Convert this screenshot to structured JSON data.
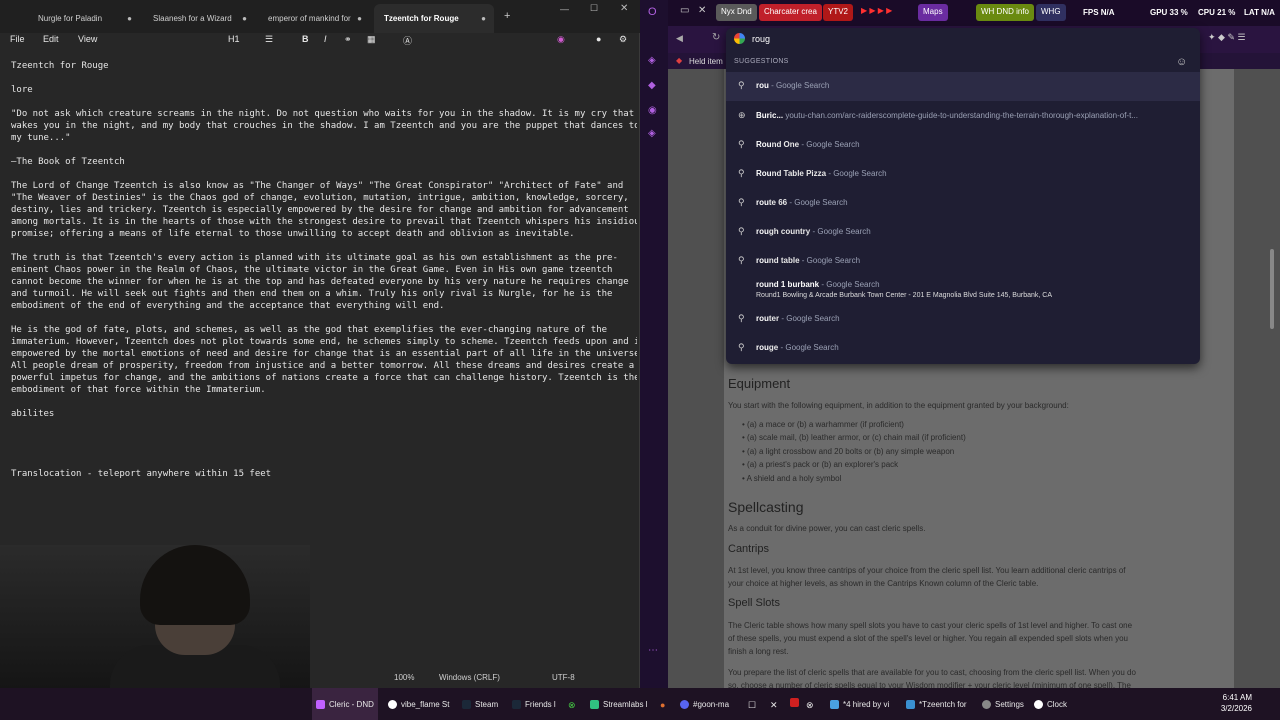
{
  "notepad": {
    "tabs": [
      "Nurgle for Paladin",
      "Slaanesh for a Wizard",
      "emperor of mankind for",
      "Tzeentch for Rouge"
    ],
    "menu": {
      "file": "File",
      "edit": "Edit",
      "view": "View",
      "heading": "H1"
    },
    "lines": [
      "Tzeentch for Rouge",
      "",
      "lore",
      "",
      "\"Do not ask which creature screams in the night. Do not question who waits for you in the shadow. It is my cry that",
      "wakes you in the night, and my body that crouches in the shadow. I am Tzeentch and you are the puppet that dances to",
      "my tune...\"",
      "",
      "—The Book of Tzeentch",
      "",
      "The Lord of Change Tzeentch is also know as \"The Changer of Ways\" \"The Great Conspirator\" \"Architect of Fate\" and",
      "\"The Weaver of Destinies\" is the Chaos god of change, evolution, mutation, intrigue, ambition, knowledge, sorcery,",
      "destiny, lies and trickery. Tzeentch is especially empowered by the desire for change and ambition for advancement",
      "among mortals. It is in the hearts of those with the strongest desire to prevail that Tzeentch whispers his insidious",
      "promise; offering a means of life eternal to those unwilling to accept death and oblivion as inevitable.",
      "",
      "The truth is that Tzeentch's every action is planned with its ultimate goal as his own establishment as the pre-",
      "eminent Chaos power in the Realm of Chaos, the ultimate victor in the Great Game. Even in His own game tzeentch",
      "cannot become the winner for when he is at the top and has defeated everyone by his very nature he requires change",
      "and turmoil. He will seek out fights and then end them on a whim. Truly his only rival is Nurgle, for he is the",
      "embodiment of the end of everything and the acceptance that everything will end.",
      "",
      "He is the god of fate, plots, and schemes, as well as the god that exemplifies the ever-changing nature of the",
      "immaterium. However, Tzeentch does not plot towards some end, he schemes simply to scheme. Tzeentch feeds upon and is",
      "empowered by the mortal emotions of need and desire for change that is an essential part of all life in the universe.",
      "All people dream of prosperity, freedom from injustice and a better tomorrow. All these dreams and desires create a",
      "powerful impetus for change, and the ambitions of nations create a force that can challenge history. Tzeentch is the",
      "embodiment of that force within the Immaterium.",
      "",
      "abilites",
      "",
      "",
      "",
      "",
      "Translocation - teleport anywhere within 15 feet"
    ],
    "status": {
      "zoom": "100%",
      "eol": "Windows (CRLF)",
      "enc": "UTF-8"
    }
  },
  "browser": {
    "bookmarks": [
      {
        "label": "Nyx Dnd",
        "color": "#5a5a5a"
      },
      {
        "label": "Charcater crea",
        "color": "#c0202a"
      },
      {
        "label": "YTV2",
        "color": "#b01818"
      },
      {
        "label": "Maps",
        "color": "#6a2ca0"
      },
      {
        "label": "WH DND info",
        "color": "#6a8a10"
      },
      {
        "label": "WHG",
        "color": "#303060"
      }
    ],
    "stats": {
      "fps": "FPS N/A",
      "gpu": "GPU 33 %",
      "cpu": "CPU 21 %",
      "lat": "LAT N/A"
    },
    "held_item": "Held item",
    "omnibox_value": "roug",
    "suggestions_header": "SUGGESTIONS",
    "suggestions": [
      {
        "icon": "search",
        "bold": "rou",
        "rest": "",
        "suffix": " - Google Search"
      },
      {
        "icon": "globe",
        "bold": "Buric...",
        "rest": "",
        "suffix": "  youtu-chan.com/arc-raiderscomplete-guide-to-understanding-the-terrain-thorough-explanation-of-t..."
      },
      {
        "icon": "search",
        "bold": "Rou",
        "rest": "nd One",
        "suffix": " - Google Search"
      },
      {
        "icon": "search",
        "bold": "Rou",
        "rest": "nd Table Pizza",
        "suffix": " - Google Search"
      },
      {
        "icon": "search",
        "bold": "rou",
        "rest": "te 66",
        "suffix": " - Google Search"
      },
      {
        "icon": "search",
        "bold": "rou",
        "rest": "gh country",
        "suffix": " - Google Search"
      },
      {
        "icon": "search",
        "bold": "rou",
        "rest": "nd table",
        "suffix": " - Google Search"
      },
      {
        "icon": "none",
        "bold": "round 1 burbank",
        "rest": "",
        "suffix": " - Google Search",
        "sub": "Round1 Bowling & Arcade Burbank Town Center - 201 E Magnolia Blvd Suite 145, Burbank, CA"
      },
      {
        "icon": "search",
        "bold": "rou",
        "rest": "ter",
        "suffix": " - Google Search"
      },
      {
        "icon": "search",
        "bold": "rou",
        "rest": "ge",
        "suffix": " - Google Search"
      }
    ],
    "page": {
      "equipment_title": "Equipment",
      "equipment_intro": "You start with the following equipment, in addition to the equipment granted by your background:",
      "equipment_items": [
        "(a) a mace or (b) a warhammer (if proficient)",
        "(a) scale mail, (b) leather armor, or (c) chain mail (if proficient)",
        "(a) a light crossbow and 20 bolts or (b) any simple weapon",
        "(a) a priest's pack or (b) an explorer's pack",
        "A shield and a holy symbol"
      ],
      "spellcasting_title": "Spellcasting",
      "spellcasting_text": "As a conduit for divine power, you can cast cleric spells.",
      "cantrips_title": "Cantrips",
      "cantrips_text1": "At 1st level, you know three cantrips of your choice from the cleric spell list. You learn additional cleric cantrips of",
      "cantrips_text2": "your choice at higher levels, as shown in the Cantrips Known column of the Cleric table.",
      "slots_title": "Spell Slots",
      "slots_text1": "The Cleric table shows how many spell slots you have to cast your cleric spells of 1st level and higher. To cast one",
      "slots_text2": "of these spells, you must expend a slot of the spell's level or higher. You regain all expended spell slots when you",
      "slots_text3": "finish a long rest.",
      "prep_text1": "You prepare the list of cleric spells that are available for you to cast, choosing from the cleric spell list. When you do",
      "prep_text2": "so, choose a number of cleric spells equal to your Wisdom modifier + your cleric level (minimum of one spell). The"
    }
  },
  "taskbar": {
    "items": [
      "Cleric - DND",
      "vibe_flame St",
      "Steam",
      "Friends l",
      "Streamlabs l",
      "#goon-ma",
      "*4 hired by vi",
      "*Tzeentch for",
      "Settings",
      "Clock"
    ],
    "time": "6:41 AM",
    "date": "3/2/2026"
  }
}
